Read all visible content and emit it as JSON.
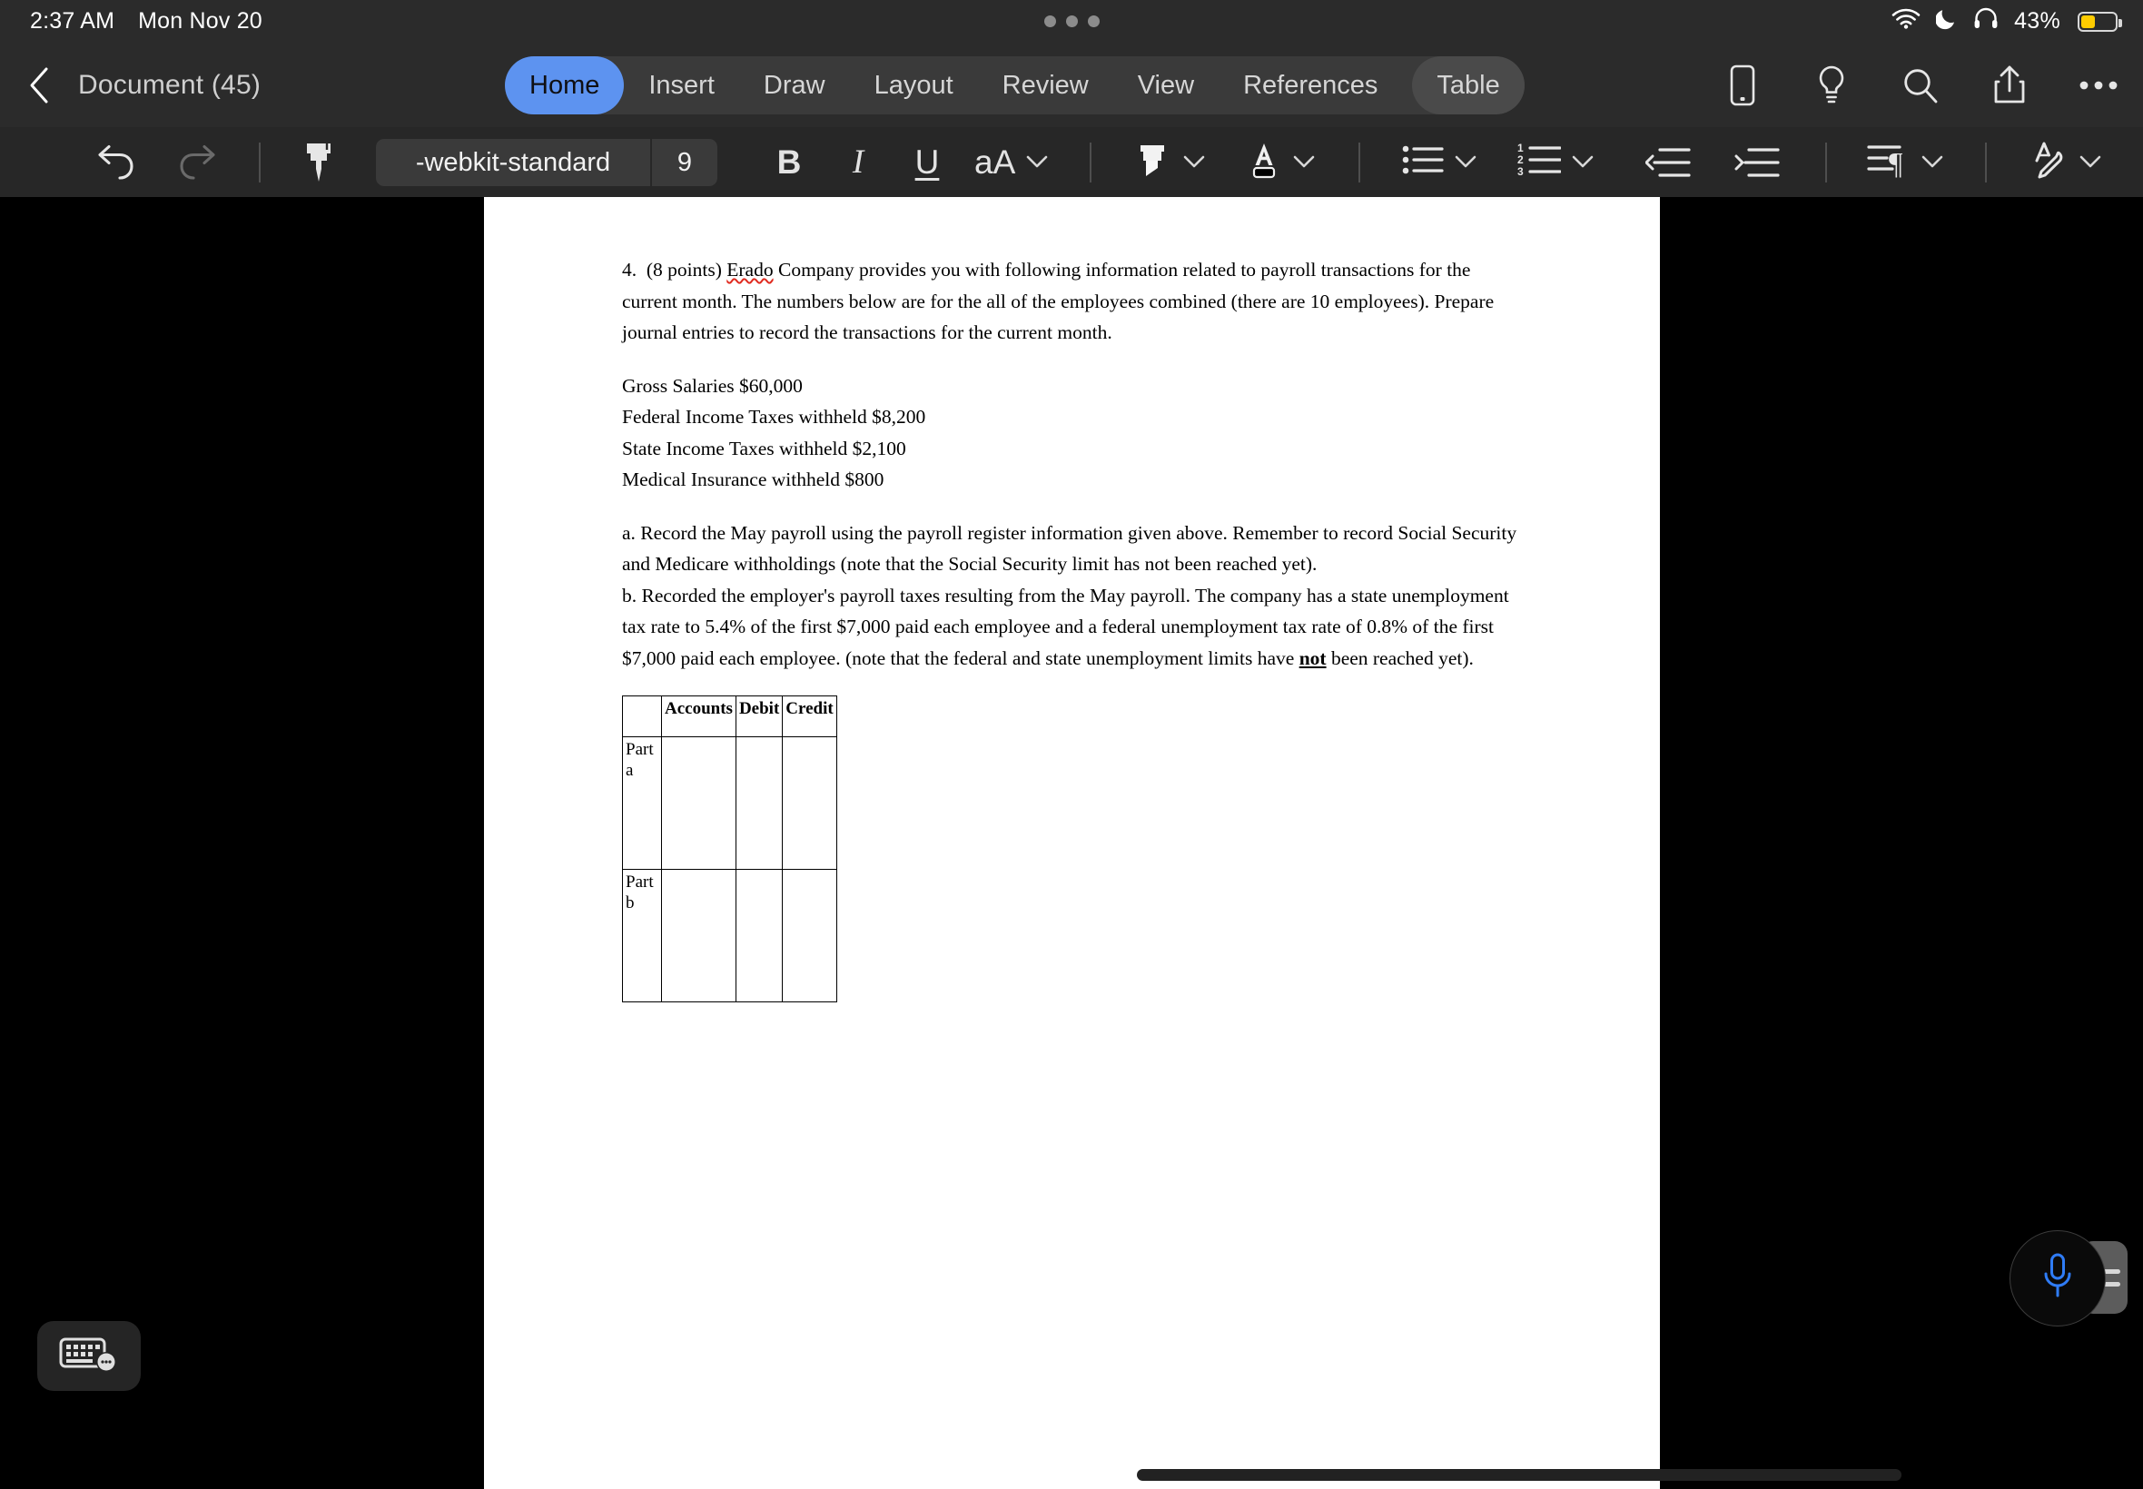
{
  "statusbar": {
    "time": "2:37 AM",
    "date": "Mon Nov 20",
    "wifi_icon": "wifi-icon",
    "dnd_icon": "moon-icon",
    "headphones_icon": "headphones-icon",
    "battery_percent": "43%",
    "battery_level": 43,
    "battery_color": "#ffcc00"
  },
  "navbar": {
    "back_icon": "back-chevron-icon",
    "document_title": "Document (45)",
    "tabs": [
      {
        "label": "Home",
        "active": true
      },
      {
        "label": "Insert",
        "active": false
      },
      {
        "label": "Draw",
        "active": false
      },
      {
        "label": "Layout",
        "active": false
      },
      {
        "label": "Review",
        "active": false
      },
      {
        "label": "View",
        "active": false
      },
      {
        "label": "References",
        "active": false
      }
    ],
    "contextual_tab": "Table",
    "active_tab_color": "#5d93f0",
    "icons": [
      "mobile-view-icon",
      "lightbulb-icon",
      "search-icon",
      "share-icon",
      "more-options-icon"
    ]
  },
  "formatbar": {
    "undo_icon": "undo-icon",
    "redo_icon": "redo-icon",
    "format_painter_icon": "format-painter-icon",
    "font_name": "-webkit-standard",
    "font_size": "9",
    "bold_label": "B",
    "italic_label": "I",
    "underline_label": "U",
    "text_effects_label": "aA",
    "highlight_icon": "highlighter-icon",
    "font_color_icon": "font-color-icon",
    "font_color_swatch": "#000000",
    "bullet_list_icon": "bullet-list-icon",
    "numbered_list_icon": "numbered-list-icon",
    "outdent_icon": "outdent-icon",
    "indent_icon": "indent-icon",
    "paragraph_mark_icon": "paragraph-mark-icon",
    "styles_icon": "styles-pen-icon"
  },
  "document": {
    "q_number": "4.",
    "q_points": "(8 points)",
    "company_misspelled": "Erado",
    "intro_rest": "Company provides you with following information related to payroll transactions for the current month.  The numbers below are for the all of the employees combined (there are 10 employees).   Prepare journal entries to record the transactions for the current month.",
    "figures": [
      "Gross Salaries $60,000",
      "Federal Income Taxes withheld $8,200",
      "State Income Taxes withheld $2,100",
      "Medical Insurance withheld  $800"
    ],
    "part_a": "a. Record the May payroll using the payroll register information given above.  Remember to record Social Security and Medicare withholdings (note that the Social Security limit has not been reached yet).",
    "part_b_1": "b. Recorded the employer's payroll taxes resulting from the May payroll. The company has a state unemployment tax rate to 5.4% of the first $7,000 paid each employee and a federal unemployment tax rate of 0.8% of the first $7,000 paid each employee. (note that the federal and state unemployment limits have ",
    "part_b_emphasis": "not",
    "part_b_2": " been reached yet).",
    "table": {
      "headers": [
        "",
        "Accounts",
        "Debit",
        "Credit"
      ],
      "rows": [
        {
          "label": "Part a",
          "accounts": "",
          "debit": "",
          "credit": ""
        },
        {
          "label": "Part b",
          "accounts": "",
          "debit": "",
          "credit": ""
        }
      ]
    }
  },
  "widgets": {
    "keyboard_icon": "keyboard-icon",
    "mic_icon": "microphone-icon",
    "mic_color": "#2f7cf6",
    "drag_handle_icon": "drag-handle-icon"
  }
}
